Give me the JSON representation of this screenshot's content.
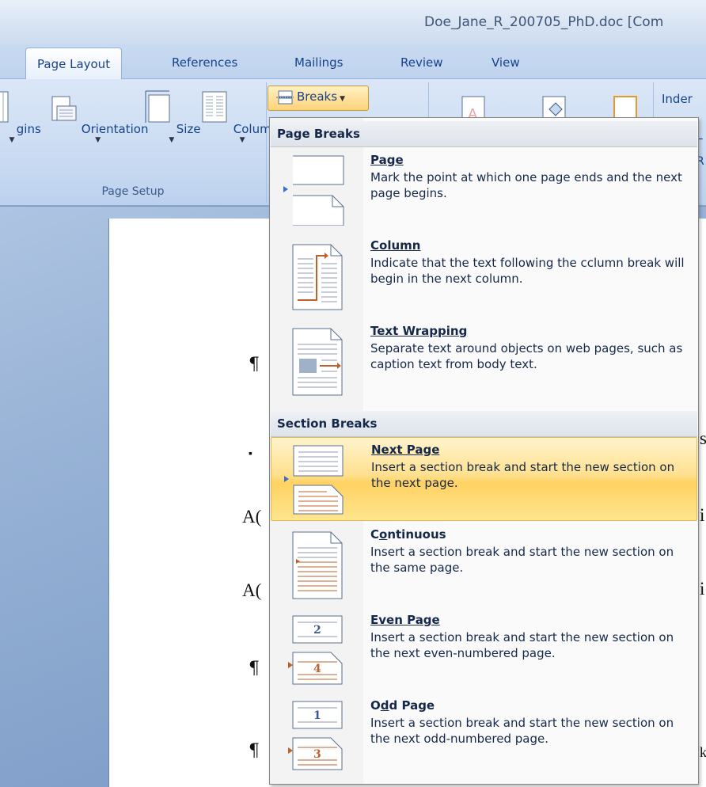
{
  "window": {
    "title": "Doe_Jane_R_200705_PhD.doc [Com"
  },
  "tabs": [
    {
      "label": "Page Layout",
      "active": true
    },
    {
      "label": "References"
    },
    {
      "label": "Mailings"
    },
    {
      "label": "Review"
    },
    {
      "label": "View"
    }
  ],
  "ribbon": {
    "page_setup": {
      "group_label": "Page Setup",
      "buttons": [
        {
          "label": "gins",
          "icon": "margins-icon"
        },
        {
          "label": "Orientation",
          "icon": "orientation-icon"
        },
        {
          "label": "Size",
          "icon": "size-icon"
        },
        {
          "label": "Columns",
          "icon": "columns-icon"
        }
      ],
      "breaks_label": "Breaks"
    },
    "indent_label": "Inder",
    "indent_sub_1": "L",
    "indent_sub_2": "R"
  },
  "document": {
    "marks": [
      "¶",
      "▪",
      "A(",
      "A(",
      "¶",
      "¶",
      "ŀ",
      "s",
      "i",
      "i",
      "k"
    ]
  },
  "breaks_menu": {
    "page_breaks_header": "Page Breaks",
    "section_breaks_header": "Section Breaks",
    "items": [
      {
        "title": "Page",
        "underline_index": 0,
        "description": "Mark the point at which one page ends and the next page begins.",
        "icon": "page-break-icon",
        "highlighted": false
      },
      {
        "title": "Column",
        "underline_index": 0,
        "description": "Indicate that the text following the cclumn break will begin in the next column.",
        "icon": "column-break-icon",
        "highlighted": false
      },
      {
        "title": "Text Wrapping",
        "underline_index": 0,
        "description": "Separate text around objects on web pages, such as caption text from body text.",
        "icon": "text-wrapping-icon",
        "highlighted": false
      },
      {
        "title": "Next Page",
        "underline_index": 0,
        "description": "Insert a section break and start the new section on the next page.",
        "icon": "next-page-icon",
        "highlighted": true
      },
      {
        "title": "Continuous",
        "underline_index": 1,
        "description": "Insert a section break and start the new section on the same page.",
        "icon": "continuous-icon",
        "highlighted": false
      },
      {
        "title": "Even Page",
        "underline_index": 0,
        "description": "Insert a section break and start the new section on the next even-numbered page.",
        "icon": "even-page-icon",
        "highlighted": false
      },
      {
        "title": "Odd Page",
        "underline_index": 1,
        "description": "Insert a section break and start the new section on the next odd-numbered page.",
        "icon": "odd-page-icon",
        "highlighted": false
      }
    ],
    "icon_numbers": {
      "even_top": "2",
      "even_bottom": "4",
      "odd_top": "1",
      "odd_bottom": "3"
    }
  },
  "colors": {
    "highlight": "#ffd262",
    "ribbon_text": "#15428b",
    "menu_border": "#868686"
  }
}
